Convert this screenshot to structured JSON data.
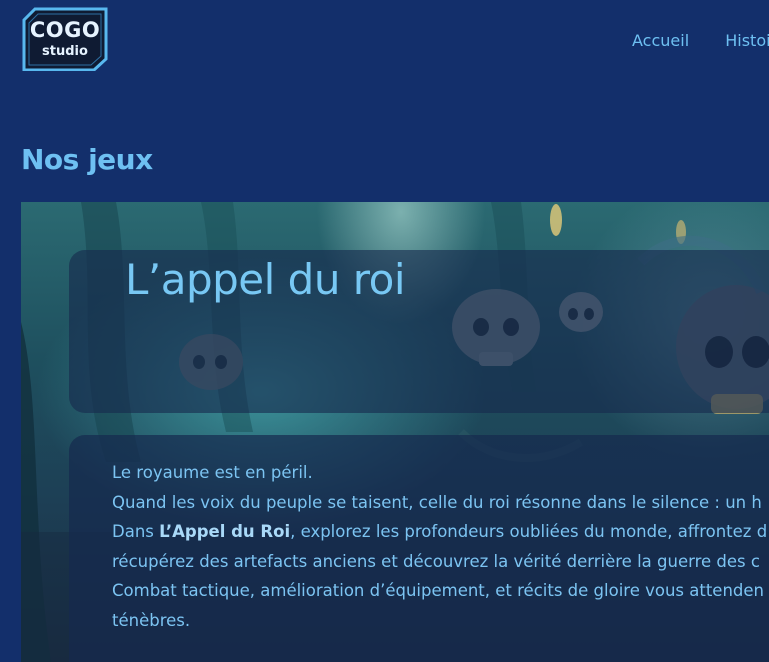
{
  "header": {
    "logo": {
      "line1": "COGO",
      "line2": "studio"
    },
    "nav": [
      {
        "label": "Accueil"
      },
      {
        "label": "Histoire"
      }
    ]
  },
  "main": {
    "section_title": "Nos jeux",
    "game": {
      "title": "L’appel du roi",
      "description": {
        "line1": "Le royaume est en péril.",
        "line2": "Quand les voix du peuple se taisent, celle du roi résonne dans le silence : un h",
        "line3_prefix": "Dans ",
        "line3_bold": "L’Appel du Roi",
        "line3_suffix": ", explorez les profondeurs oubliées du monde, affrontez d",
        "line4": "récupérez des artefacts anciens et découvrez la vérité derrière la guerre des c",
        "line5": "Combat tactique, amélioration d’équipement, et récits de gloire vous attenden",
        "line6": "ténèbres."
      }
    }
  },
  "colors": {
    "page_background": "#132f6b",
    "accent_text": "#6ec0f2",
    "panel_background": "#162a4e"
  }
}
